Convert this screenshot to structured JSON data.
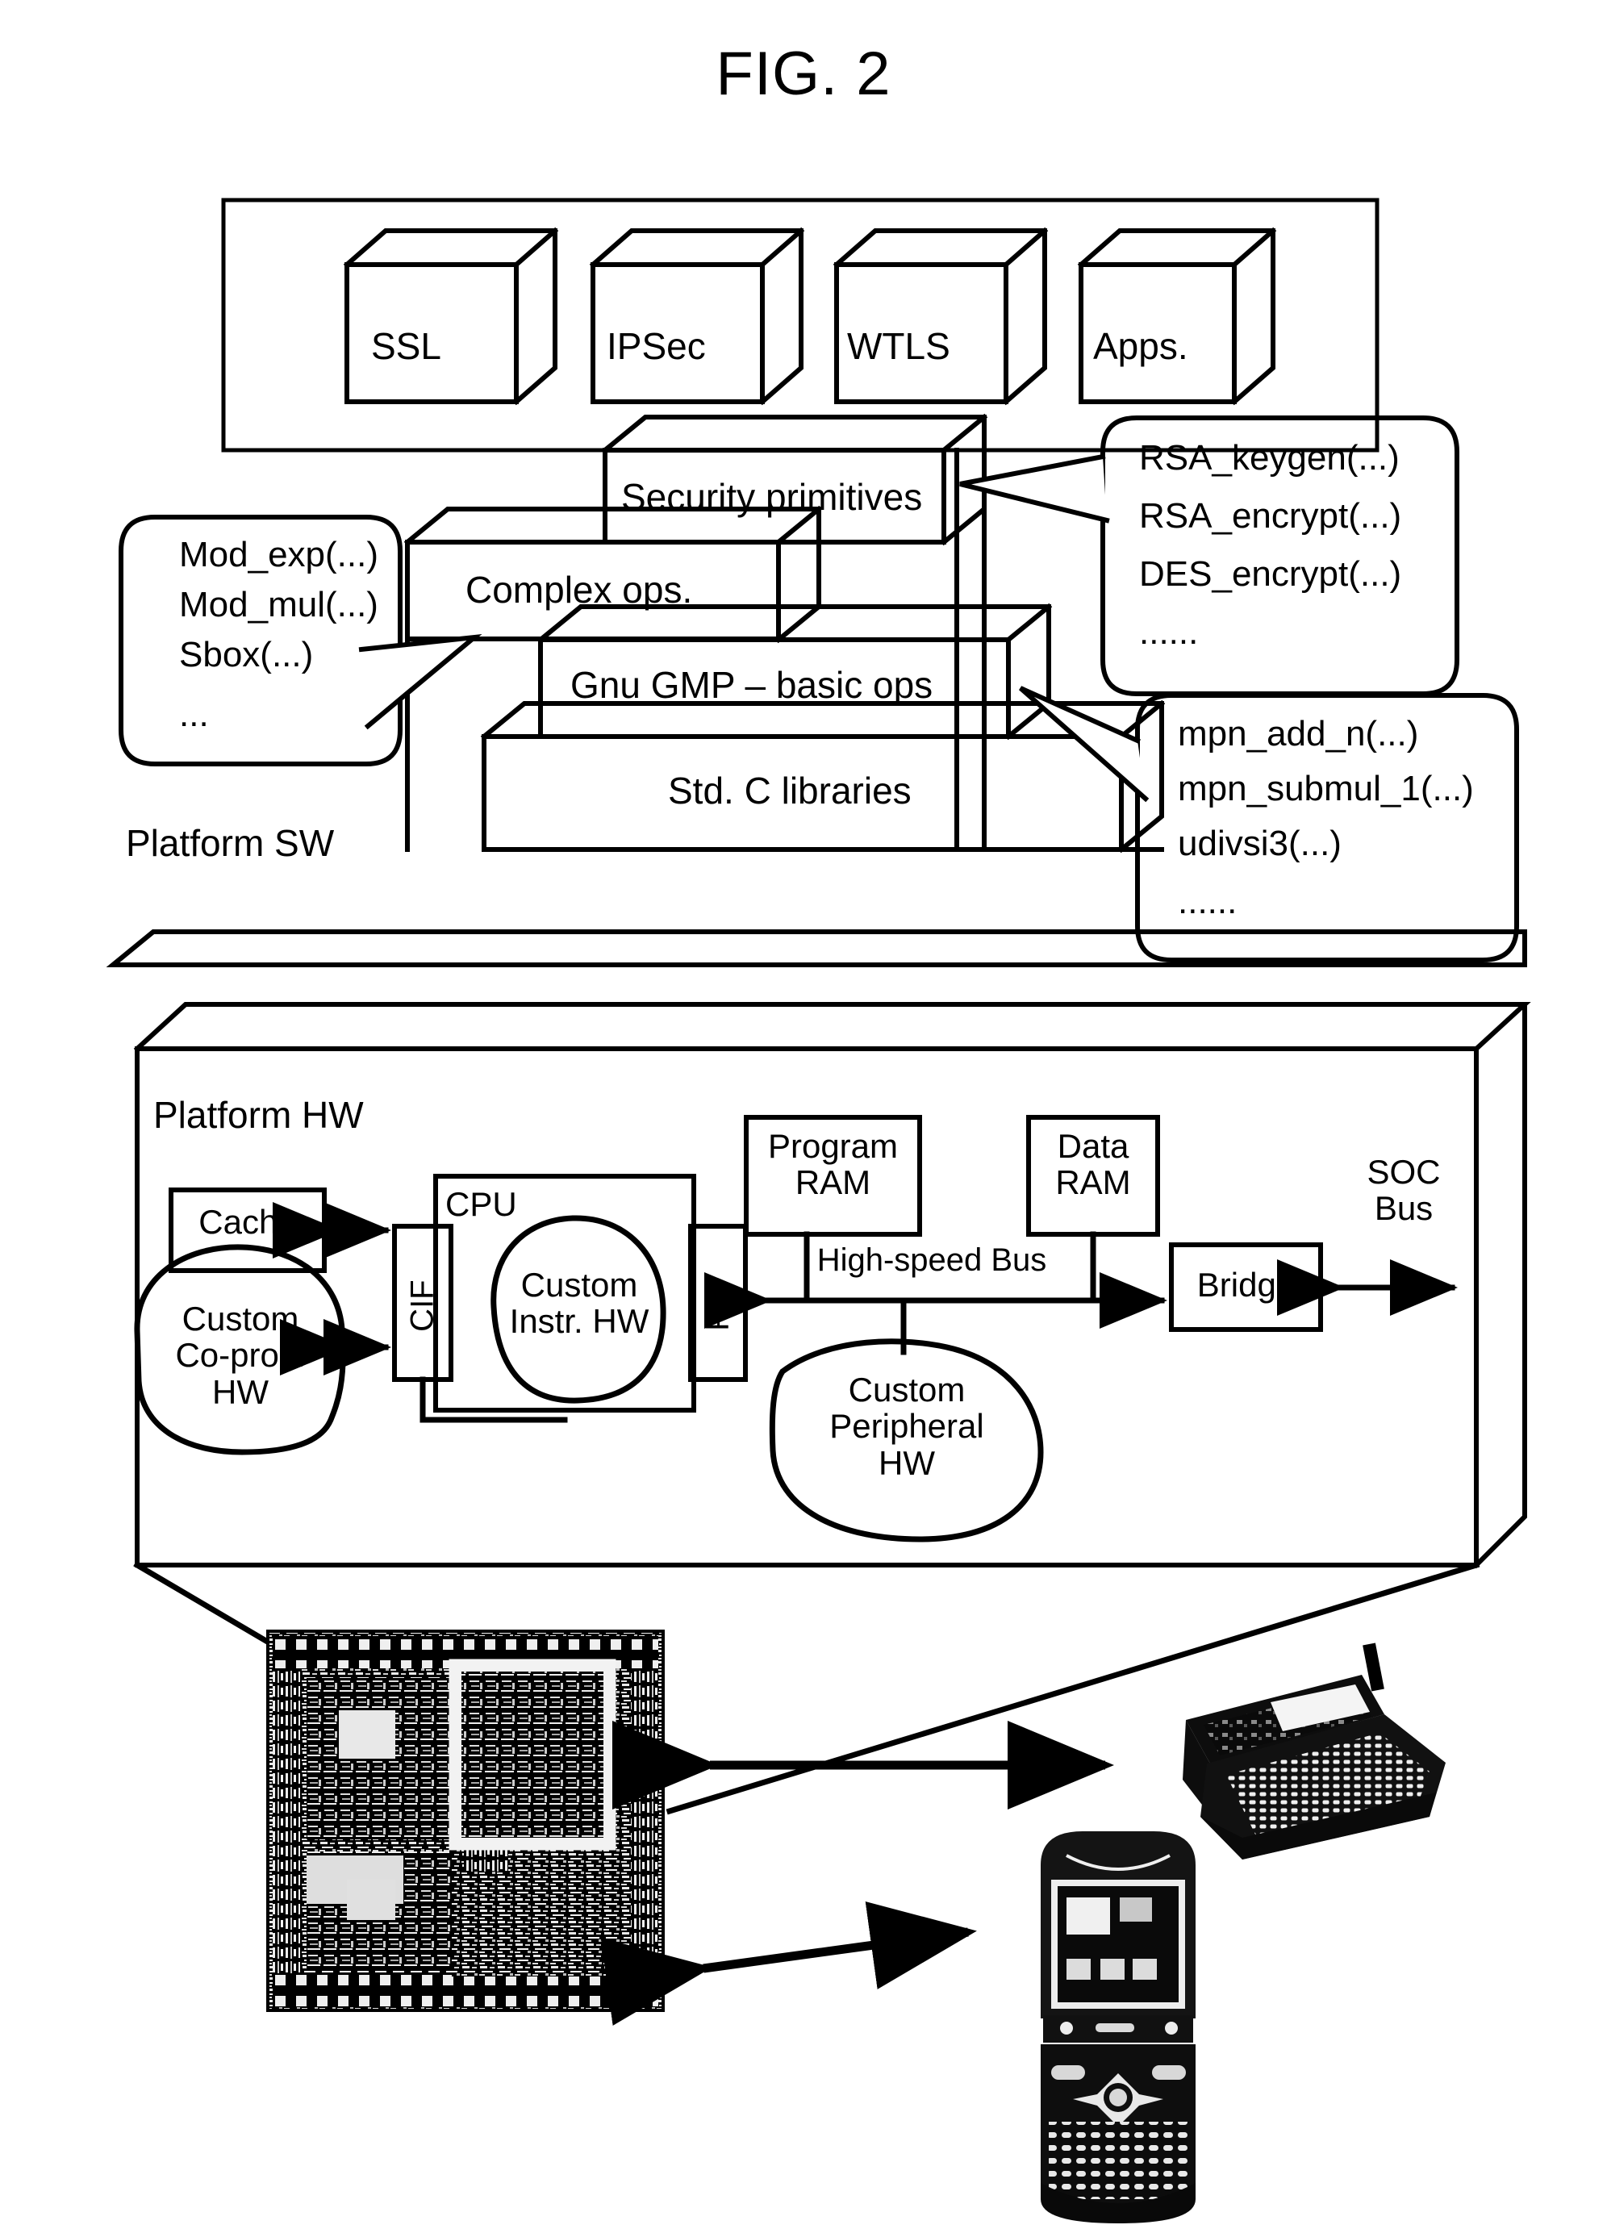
{
  "figure": {
    "title": "FIG. 2"
  },
  "applications": {
    "cubes": [
      {
        "label": "SSL"
      },
      {
        "label": "IPSec"
      },
      {
        "label": "WTLS"
      },
      {
        "label": "Apps."
      }
    ]
  },
  "software_stack": {
    "platform_label": "Platform SW",
    "layers": [
      {
        "label": "Security primitives"
      },
      {
        "label": "Complex ops."
      },
      {
        "label": "Gnu GMP – basic ops"
      },
      {
        "label": "Std. C libraries"
      }
    ]
  },
  "callouts": {
    "complex_ops": {
      "lines": [
        "Mod_exp(...)",
        "Mod_mul(...)",
        "Sbox(...)",
        "..."
      ]
    },
    "security_primitives": {
      "lines": [
        "RSA_keygen(...)",
        "RSA_encrypt(...)",
        "DES_encrypt(...)",
        "......"
      ]
    },
    "gmp": {
      "lines": [
        "mpn_add_n(...)",
        "mpn_submul_1(...)",
        "udivsi3(...)",
        "......"
      ]
    }
  },
  "hardware": {
    "platform_label": "Platform HW",
    "blocks": {
      "cache": "Cache",
      "custom_coproc": "Custom\nCo-proc.\nHW",
      "cif": "CIF",
      "cpu": "CPU",
      "custom_instr_hw": "Custom\nInstr. HW",
      "pif": "PIF",
      "program_ram": "Program\nRAM",
      "data_ram": "Data\nRAM",
      "high_speed_bus": "High-speed Bus",
      "custom_peripheral": "Custom\nPeripheral\nHW",
      "bridge": "Bridge",
      "soc_bus": "SOC\nBus"
    }
  },
  "devices": {
    "chip_die": "chip-die-photo",
    "pda": "handheld-pda-photo",
    "phone": "flip-phone-photo"
  },
  "colors": {
    "ink": "#000000",
    "paper": "#ffffff"
  }
}
